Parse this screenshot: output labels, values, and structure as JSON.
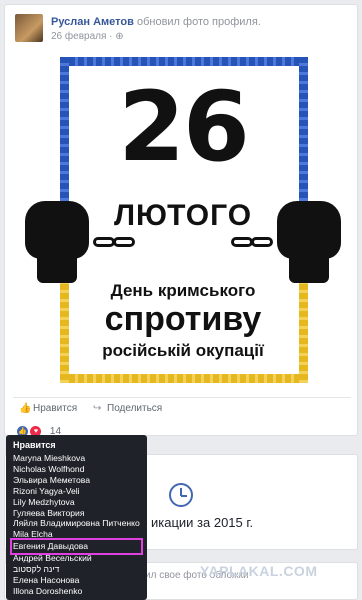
{
  "post": {
    "author": "Руслан Аметов",
    "action": "обновил фото профиля.",
    "date": "26 февраля",
    "separator": "·",
    "privacy_icon": "globe-icon"
  },
  "poster": {
    "number": "26",
    "month": "ЛЮТОГО",
    "line1": "День кримського",
    "line2": "спротиву",
    "line3": "російській окупації",
    "colors": {
      "top": "#2553b8",
      "bottom": "#e5b820"
    }
  },
  "actions": {
    "like": "Нравится",
    "share": "Поделиться"
  },
  "reactions": {
    "count": "14",
    "types": [
      "like-icon",
      "love-icon"
    ]
  },
  "tooltip": {
    "title": "Нравится",
    "names": [
      "Maryna Mieshkova",
      "Nicholas Wolfhond",
      "Эльвира Меметова",
      "Rizoni Yagya-Veli",
      "Lily Medzhytova",
      "Гуляева Виктория",
      "Ляйля Владимировна Питченко",
      "Mila Elcha",
      "Евгения Давыдова",
      "Андрей Весельский",
      "דינה לקסטוב",
      "Елена Насонова",
      "Illona Doroshenko"
    ],
    "highlighted_index": 8
  },
  "memory_card": {
    "text": "икации за 2015 г.",
    "icon": "clock-icon"
  },
  "next_card": {
    "text": "ил свое фото обложки"
  },
  "watermark": "YAPLAKAL.COM"
}
